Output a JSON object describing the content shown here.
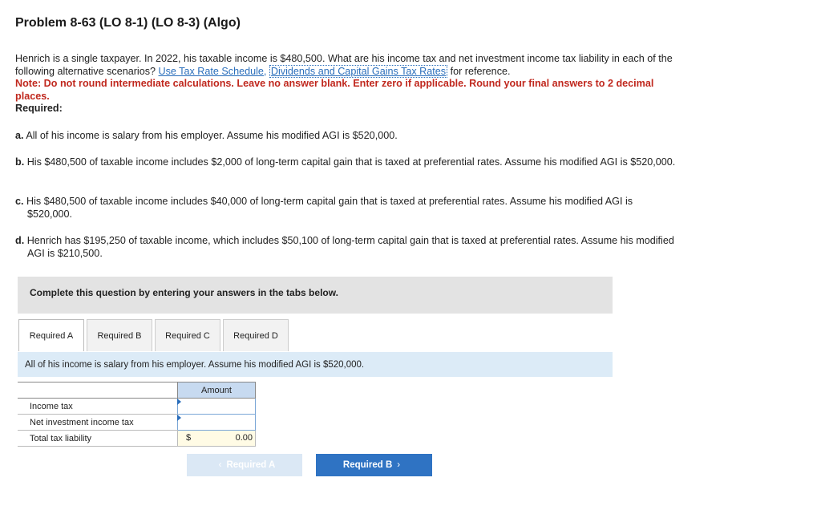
{
  "title": "Problem 8-63 (LO 8-1) (LO 8-3) (Algo)",
  "intro": {
    "text1": "Henrich is a single taxpayer. In 2022, his taxable income is $480,500. What are his income tax and net investment income tax liability in each of the following alternative scenarios? ",
    "link1": "Use Tax Rate Schedule,",
    "link2": "Dividends and Capital Gains Tax Rates",
    "text2": " for reference.",
    "note": "Note: Do not round intermediate calculations. Leave no answer blank. Enter zero if applicable. Round your final answers to 2 decimal places.",
    "required": "Required:"
  },
  "items": [
    {
      "label": "a.",
      "text": "All of his income is salary from his employer. Assume his modified AGI is $520,000."
    },
    {
      "label": "b.",
      "text": "His $480,500 of taxable income includes $2,000 of long-term capital gain that is taxed at preferential rates. Assume his modified AGI is $520,000."
    },
    {
      "label": "c.",
      "text": "His $480,500 of taxable income includes $40,000 of long-term capital gain that is taxed at preferential rates. Assume his modified AGI is $520,000."
    },
    {
      "label": "d.",
      "text": "Henrich has $195,250 of taxable income, which includes $50,100 of long-term capital gain that is taxed at preferential rates. Assume his modified AGI is $210,500."
    }
  ],
  "complete_text": "Complete this question by entering your answers in the tabs below.",
  "tabs": [
    "Required A",
    "Required B",
    "Required C",
    "Required D"
  ],
  "tab_content": "All of his income is salary from his employer. Assume his modified AGI is $520,000.",
  "table": {
    "header": "Amount",
    "rows": [
      {
        "label": "Income tax",
        "value": ""
      },
      {
        "label": "Net investment income tax",
        "value": ""
      },
      {
        "label": "Total tax liability",
        "currency": "$",
        "value": "0.00"
      }
    ]
  },
  "nav": {
    "prev": "Required A",
    "next": "Required B"
  },
  "colors": {
    "accent": "#2f73c3",
    "note": "#c0281e",
    "tab_content_bg": "#dcebf7"
  }
}
